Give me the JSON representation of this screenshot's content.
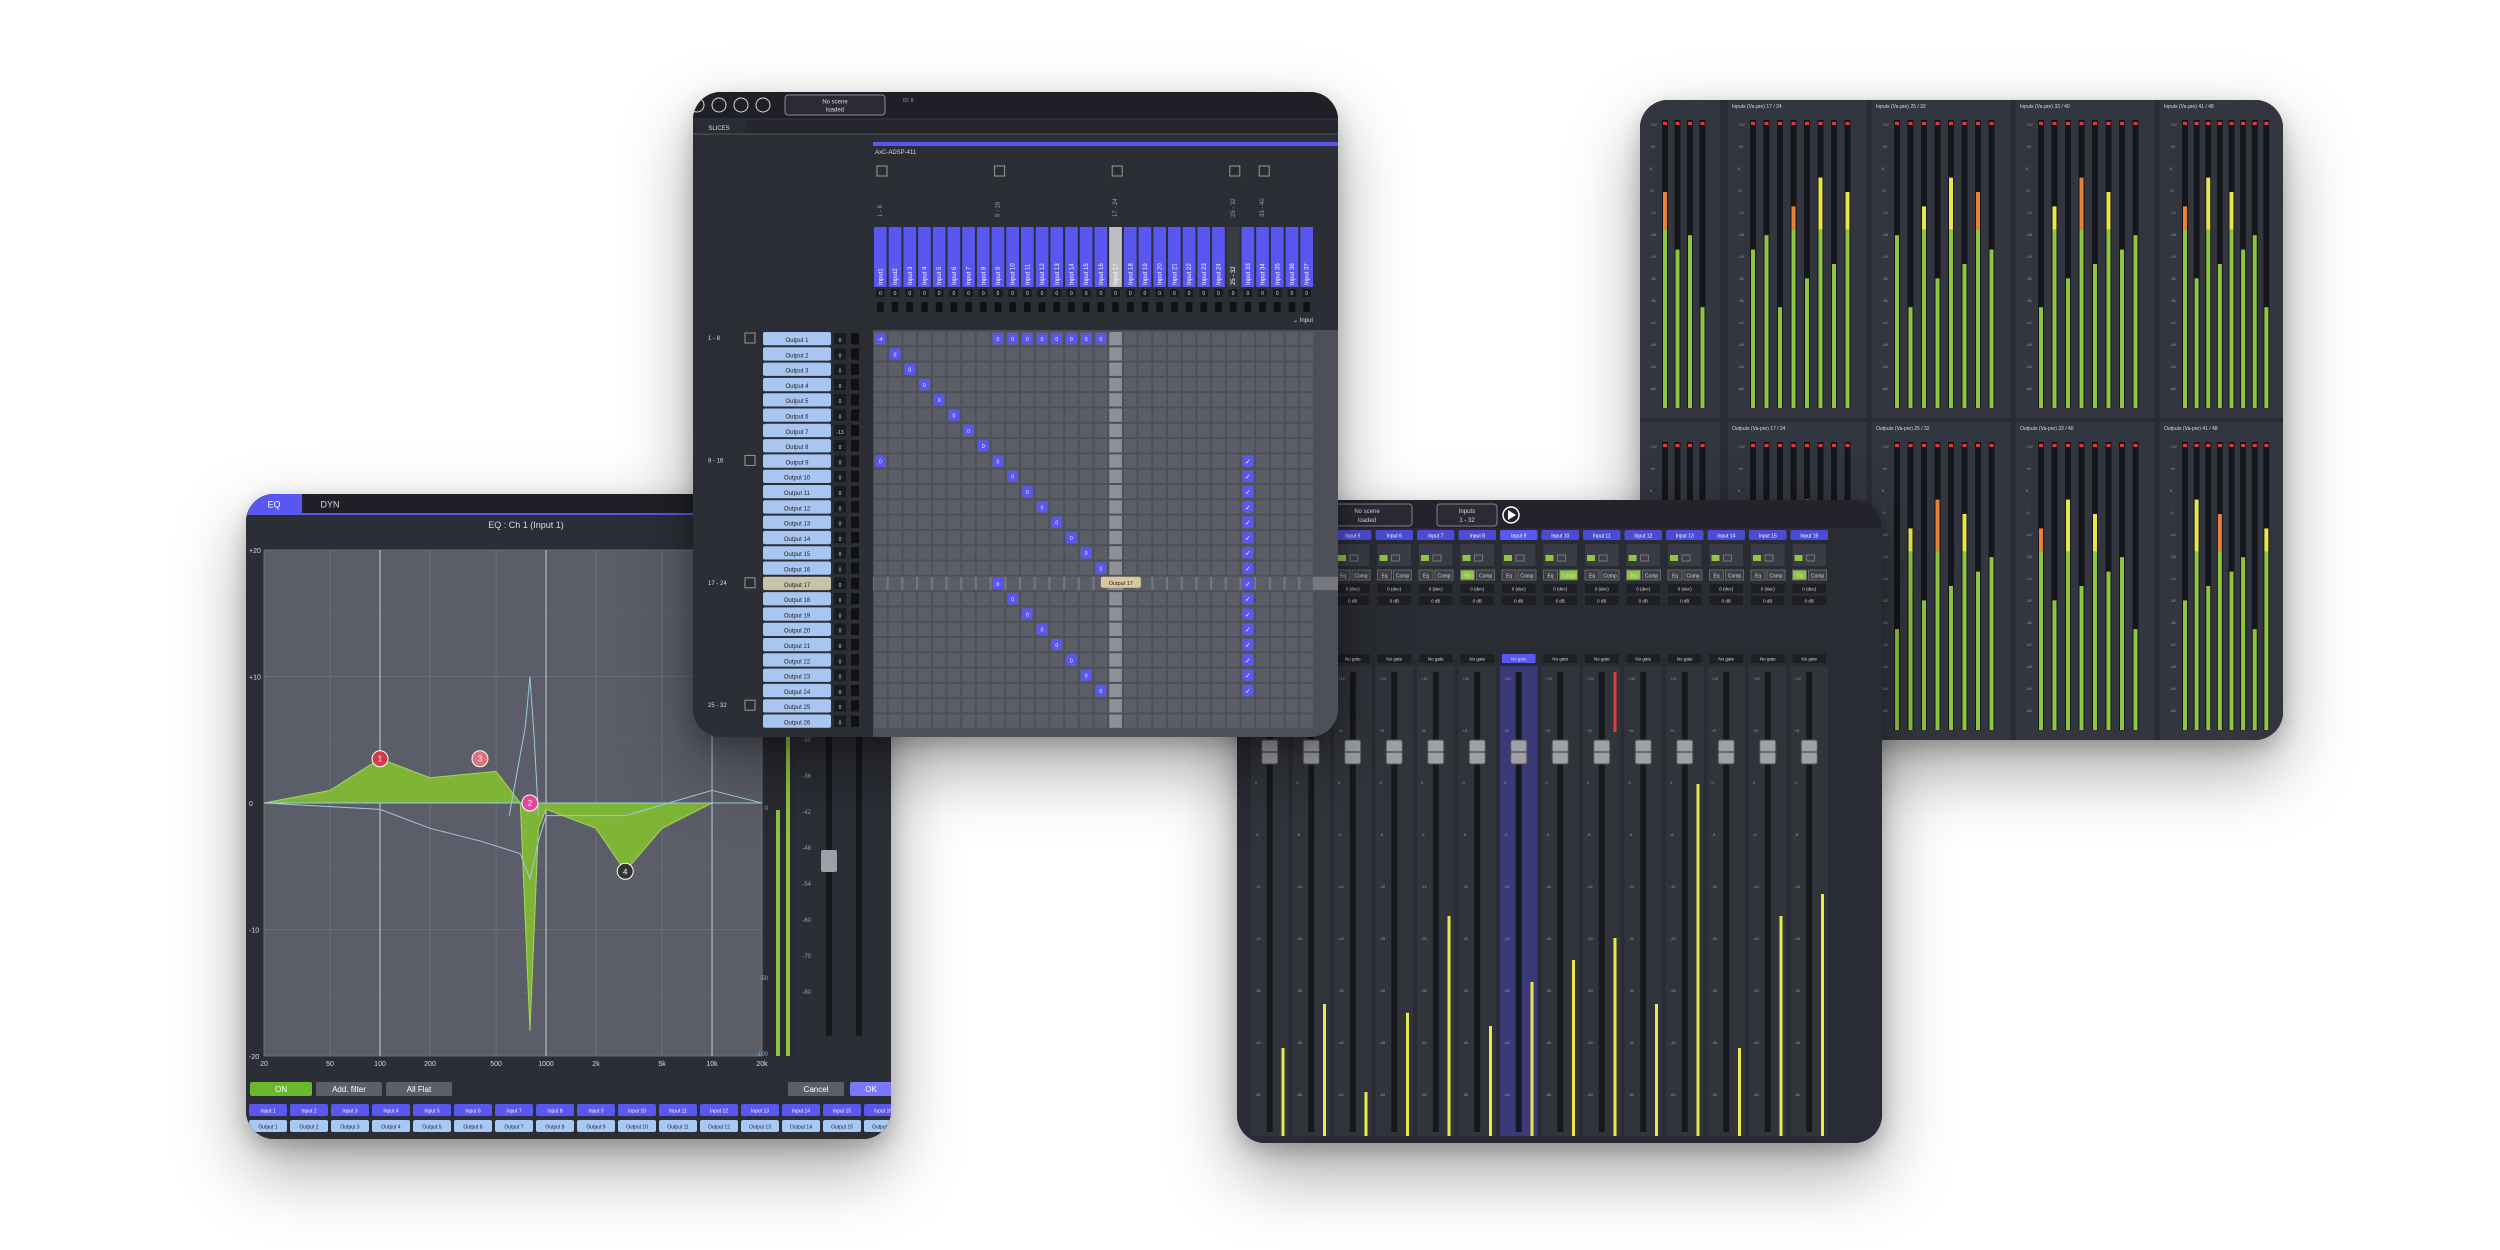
{
  "meters": {
    "top_headers": [
      "Inputs (Va-pre) 17 / 24",
      "Inputs (Va-pre) 25 / 32",
      "Inputs (Va-pre) 33 / 40",
      "Inputs (Va-pre) 41 / 48"
    ],
    "bottom_headers": [
      "Outputs (Va-pre) 17 / 24",
      "Outputs (Va-pre) 25 / 32",
      "Outputs (Va-pre) 33 / 40",
      "Outputs (Va-pre) 41 / 48"
    ],
    "scale": [
      "+12",
      "+6",
      "0",
      "-6",
      "-12",
      "-18",
      "-24",
      "-30",
      "-36",
      "-42",
      "-48",
      "-54",
      "-60"
    ]
  },
  "mixer": {
    "scene_label_1": "No scene",
    "scene_label_2": "loaded",
    "bank_label_1": "Inputs",
    "bank_label_2": "1 - 32",
    "channels": [
      "Input 3",
      "Input 4",
      "Input 5",
      "Input 6",
      "Input 7",
      "Input 8",
      "Input 9",
      "Input 10",
      "Input 11",
      "Input 12",
      "Input 13",
      "Input 14",
      "Input 15",
      "Input 16"
    ],
    "eq_label": "Eq",
    "comp_label": "Comp",
    "gain": "0 (dec)",
    "db": "0 dB",
    "pan": "No gate",
    "fader_scale": [
      "+12",
      "+6",
      "0",
      "-6",
      "-12",
      "-20",
      "-30",
      "-40",
      "-60"
    ],
    "meter_levels": [
      0.2,
      0.3,
      0.1,
      0.28,
      0.5,
      0.25,
      0.35,
      0.4,
      0.45,
      0.3,
      0.8,
      0.2,
      0.5,
      0.55,
      0.6,
      0.3,
      0.25,
      0.2
    ]
  },
  "eq": {
    "tab_eq": "EQ",
    "tab_dyn": "DYN",
    "title": "EQ : Ch 1 (Input 1)",
    "y_labels": [
      "+20",
      "+10",
      "0",
      "-10",
      "-20"
    ],
    "x_labels": [
      "20",
      "50",
      "100",
      "200",
      "500",
      "1000",
      "2k",
      "5k",
      "10k",
      "20k"
    ],
    "meter_scale": [
      "0",
      "-6",
      "-12",
      "-18",
      "-24",
      "-30",
      "-36",
      "-42",
      "-48",
      "-54",
      "-60",
      "-70",
      "-80"
    ],
    "meter_right_labels": [
      "0",
      "-50",
      "-100"
    ],
    "nodes": [
      "1",
      "3",
      "2",
      "4"
    ],
    "on_label": "ON",
    "add_filter": "Add. filter",
    "all_flat": "All Flat",
    "cancel": "Cancel",
    "ok": "OK",
    "input_chips": [
      "Input 1",
      "Input 2",
      "Input 3",
      "Input 4",
      "Input 5",
      "Input 6",
      "Input 7",
      "Input 8",
      "Input 9",
      "Input 10",
      "Input 11",
      "Input 12",
      "Input 13",
      "Input 14",
      "Input 15",
      "Input 16"
    ],
    "output_chips": [
      "Output 1",
      "Output 2",
      "Output 3",
      "Output 4",
      "Output 5",
      "Output 6",
      "Output 7",
      "Output 8",
      "Output 9",
      "Output 10",
      "Output 11",
      "Output 12",
      "Output 13",
      "Output 14",
      "Output 15",
      "Output 16"
    ],
    "curve_points": [
      [
        20,
        0
      ],
      [
        50,
        1
      ],
      [
        100,
        3.5
      ],
      [
        200,
        2
      ],
      [
        500,
        2.5
      ],
      [
        700,
        0
      ],
      [
        800,
        -18
      ],
      [
        900,
        -2
      ],
      [
        1000,
        -0.5
      ],
      [
        2000,
        -2
      ],
      [
        3000,
        -5.4
      ],
      [
        5000,
        -2
      ],
      [
        10000,
        0
      ],
      [
        20000,
        0
      ]
    ]
  },
  "matrix": {
    "scene_label_1": "No scene",
    "scene_label_2": "loaded",
    "info": "ID: 8",
    "slices": "SLICES",
    "device": "AxC-ADSP-411",
    "group_labels": [
      "1 - 8",
      "9 - 16",
      "17 - 24",
      "25 - 32",
      "33 - 40"
    ],
    "inputs": [
      "Input1",
      "Input2",
      "Input 3",
      "Input 4",
      "Input 5",
      "Input 6",
      "Input 7",
      "Input 8",
      "Input 9",
      "Input 10",
      "Input 11",
      "Input 12",
      "Input 13",
      "Input 14",
      "Input 15",
      "Input 16",
      "Input 17",
      "Input 18",
      "Input 19",
      "Input 20",
      "Input 21",
      "Input 22",
      "Input 23",
      "Input 24",
      "25 - 32",
      "Input 33",
      "Input 34",
      "Input 35",
      "Input 36",
      "Input 37"
    ],
    "outputs": [
      "Output 1",
      "Output 2",
      "Output 3",
      "Output 4",
      "Output 5",
      "Output 6",
      "Output 7",
      "Output 8",
      "Output 9",
      "Output 10",
      "Output 11",
      "Output 12",
      "Output 13",
      "Output 14",
      "Output 15",
      "Output 16",
      "Output 17",
      "Output 18",
      "Output 19",
      "Output 20",
      "Output 21",
      "Output 22",
      "Output 23",
      "Output 24",
      "Output 25",
      "Output 26"
    ],
    "row_groups": [
      "1 - 8",
      "9 - 16",
      "17 - 24",
      "25 - 32"
    ],
    "input_dropdown": "Input",
    "tooltip": "Output 17",
    "cell_value": "0",
    "cell_value_first": "-4",
    "check": "✓",
    "side_value": "0",
    "side_value_alt": "-13"
  }
}
